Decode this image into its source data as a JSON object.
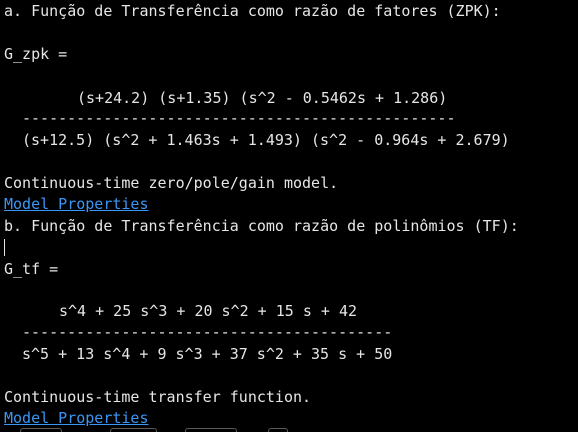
{
  "zpk": {
    "heading": "a. Função de Transferência como razão de fatores (ZPK):",
    "var_label": "G_zpk =",
    "numerator": "(s+24.2) (s+1.35) (s^2 - 0.5462s + 1.286)",
    "divider": "------------------------------------------------",
    "denominator": "(s+12.5) (s^2 + 1.463s + 1.493) (s^2 - 0.964s + 2.679)",
    "model_text": "Continuous-time zero/pole/gain model.",
    "link_label": "Model Properties"
  },
  "tf": {
    "heading": "b. Função de Transferência como razão de polinômios (TF):",
    "var_label": "G_tf =",
    "numerator": "s^4 + 25 s^3 + 20 s^2 + 15 s + 42",
    "divider": "-----------------------------------------",
    "denominator": "s^5 + 13 s^4 + 9 s^3 + 37 s^2 + 35 s + 50",
    "model_text": "Continuous-time transfer function.",
    "link_label": "Model Properties"
  }
}
